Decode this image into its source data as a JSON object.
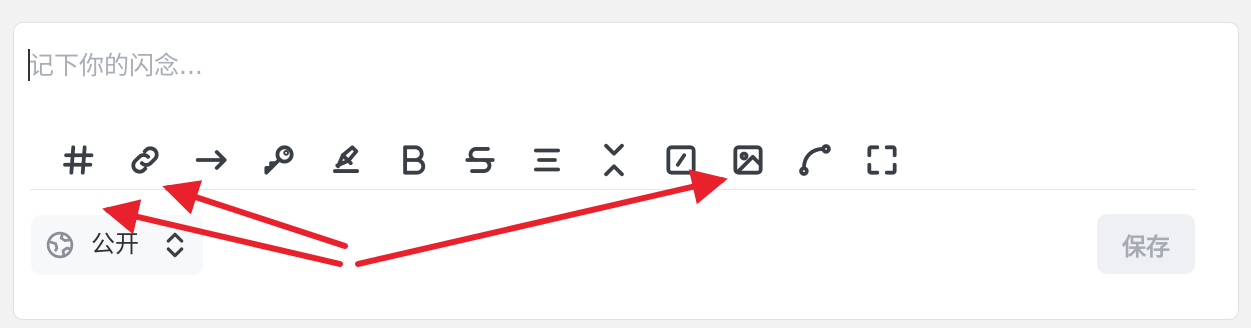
{
  "editor": {
    "placeholder": "记下你的闪念..."
  },
  "toolbar": {
    "tools": [
      {
        "icon": "hashtag-icon"
      },
      {
        "icon": "link-icon"
      },
      {
        "icon": "arrow-right-icon"
      },
      {
        "icon": "key-icon"
      },
      {
        "icon": "highlighter-icon"
      },
      {
        "icon": "bold-icon"
      },
      {
        "icon": "strikethrough-icon"
      },
      {
        "icon": "align-center-icon"
      },
      {
        "icon": "collapse-icon"
      },
      {
        "icon": "square-slash-icon"
      },
      {
        "icon": "image-icon"
      },
      {
        "icon": "curve-icon"
      },
      {
        "icon": "fullscreen-icon"
      }
    ]
  },
  "footer": {
    "visibility_label": "公开",
    "save_label": "保存"
  },
  "annotations": {
    "arrow_color": "#e8212d"
  }
}
